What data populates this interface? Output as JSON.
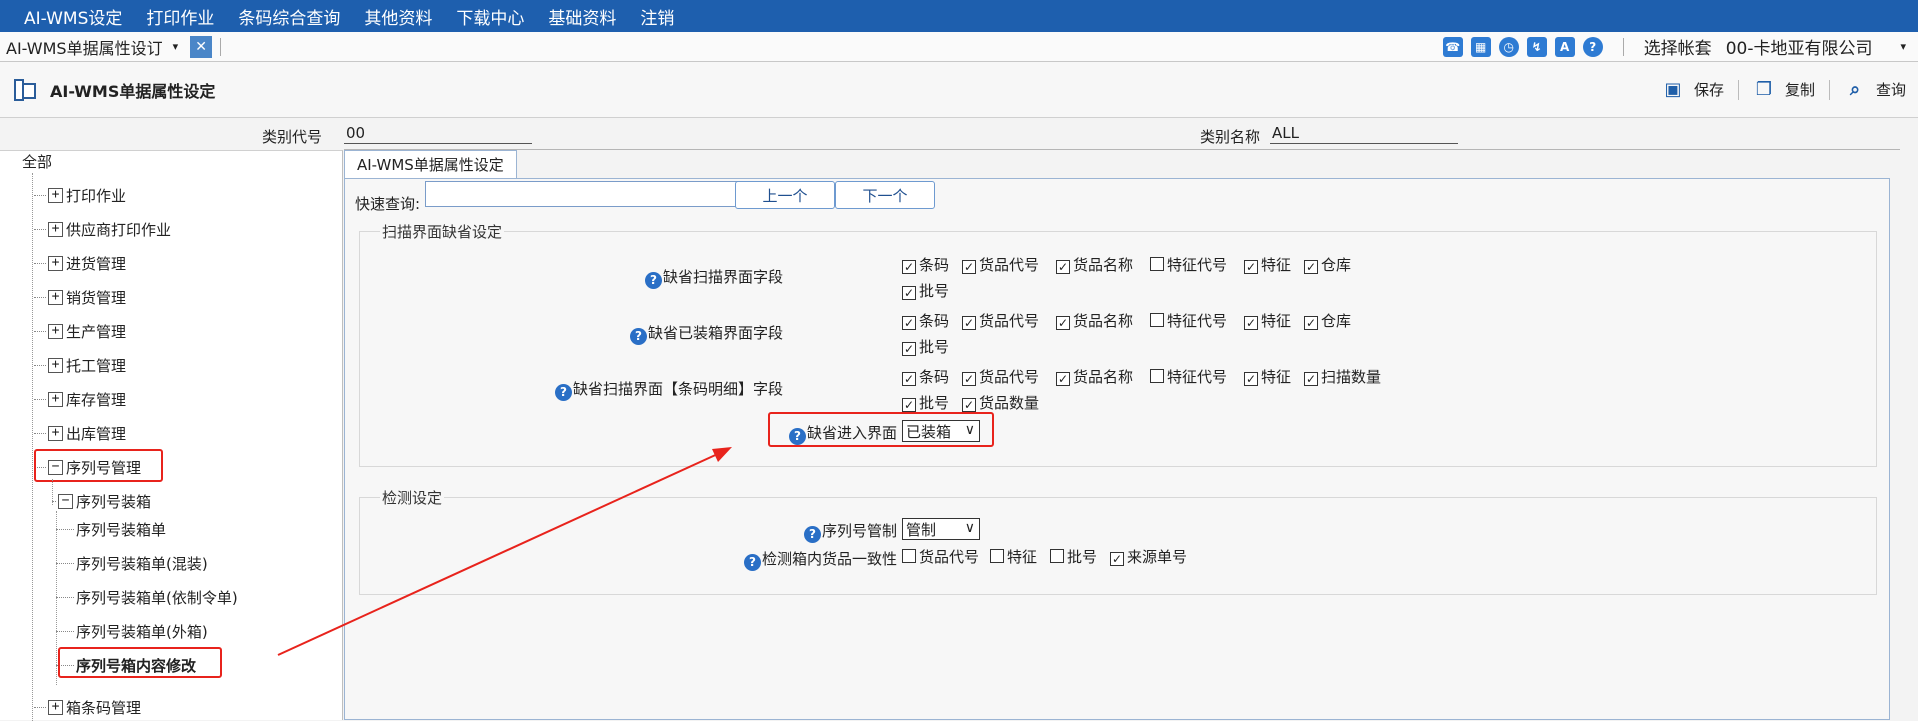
{
  "menu": [
    "AI-WMS设定",
    "打印作业",
    "条码综合查询",
    "其他资料",
    "下载中心",
    "基础资料",
    "注销"
  ],
  "tab": {
    "title": "AI-WMS单据属性设订"
  },
  "account": {
    "label": "选择帐套",
    "value": "00-卡地亚有限公司"
  },
  "page": {
    "title": "AI-WMS单据属性设定"
  },
  "actions": {
    "save": "保存",
    "copy": "复制",
    "query": "查询"
  },
  "fields": {
    "category_code_label": "类别代号",
    "category_code_value": "00",
    "category_name_label": "类别名称",
    "category_name_value": "ALL"
  },
  "tree": {
    "root": "全部",
    "items": [
      "打印作业",
      "供应商打印作业",
      "进货管理",
      "销货管理",
      "生产管理",
      "托工管理",
      "库存管理",
      "出库管理",
      "序列号管理"
    ],
    "sub_group": "序列号装箱",
    "leaves": [
      "序列号装箱单",
      "序列号装箱单(混装)",
      "序列号装箱单(依制令单)",
      "序列号装箱单(外箱)",
      "序列号箱内容修改"
    ],
    "last": "箱条码管理"
  },
  "main": {
    "tab": "AI-WMS单据属性设定",
    "quick_search_label": "快速查询:",
    "prev": "上一个",
    "next": "下一个",
    "group1_title": "扫描界面缺省设定",
    "row1_label": "缺省扫描界面字段",
    "row2_label": "缺省已装箱界面字段",
    "row3_label": "缺省扫描界面【条码明细】字段",
    "row4_label": "缺省进入界面",
    "row4_value": "已装箱",
    "opts": {
      "barcode": "条码",
      "item_code": "货品代号",
      "item_name": "货品名称",
      "feature_code": "特征代号",
      "feature": "特征",
      "warehouse": "仓库",
      "batch": "批号",
      "scan_qty": "扫描数量",
      "item_qty": "货品数量",
      "source_no": "来源单号"
    },
    "group2_title": "检测设定",
    "serial_label": "序列号管制",
    "serial_value": "管制",
    "consistency_label": "检测箱内货品一致性"
  },
  "colors": {
    "menubar": "#1e5fae",
    "highlight": "#e8231c",
    "accent": "#2a6fc6"
  }
}
